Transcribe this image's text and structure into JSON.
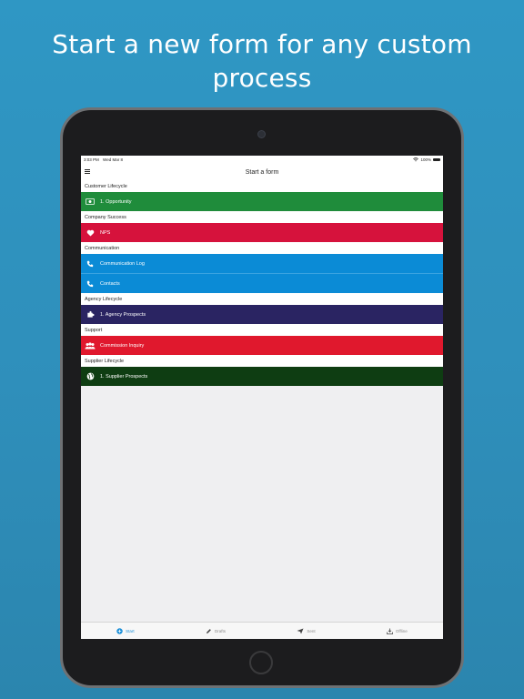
{
  "headline": "Start a new form for any custom process",
  "status_bar": {
    "time": "3:03 PM",
    "date": "Wed Mar 8",
    "battery": "100%"
  },
  "nav": {
    "title": "Start a form"
  },
  "sections": [
    {
      "title": "Customer Lifecycle",
      "items": [
        {
          "label": "1. Opportunity",
          "color": "#1f8c3b",
          "icon": "money-icon"
        }
      ]
    },
    {
      "title": "Company Success",
      "items": [
        {
          "label": "NPS",
          "color": "#d6123c",
          "icon": "heart-icon"
        }
      ]
    },
    {
      "title": "Communication",
      "items": [
        {
          "label": "Communication Log",
          "color": "#0b8bd6",
          "icon": "phone-icon"
        },
        {
          "label": "Contacts",
          "color": "#0b8bd6",
          "icon": "phone-icon"
        }
      ]
    },
    {
      "title": "Agency Lifecycle",
      "items": [
        {
          "label": "1. Agency Prospects",
          "color": "#2a2462",
          "icon": "puzzle-icon"
        }
      ]
    },
    {
      "title": "Support",
      "items": [
        {
          "label": "Commission Inquiry",
          "color": "#e0182d",
          "icon": "people-icon"
        }
      ]
    },
    {
      "title": "Supplier Lifecycle",
      "items": [
        {
          "label": "1. Supplier Prospects",
          "color": "#0e3d12",
          "icon": "globe-icon"
        }
      ]
    }
  ],
  "tabs": [
    {
      "label": "Start",
      "icon": "plus-icon",
      "active": true
    },
    {
      "label": "Drafts",
      "icon": "pencil-icon",
      "active": false
    },
    {
      "label": "Sent",
      "icon": "send-icon",
      "active": false
    },
    {
      "label": "Offline",
      "icon": "download-icon",
      "active": false
    }
  ],
  "colors": {
    "background": "#2f92bf",
    "active_tab": "#1a8fd8"
  }
}
